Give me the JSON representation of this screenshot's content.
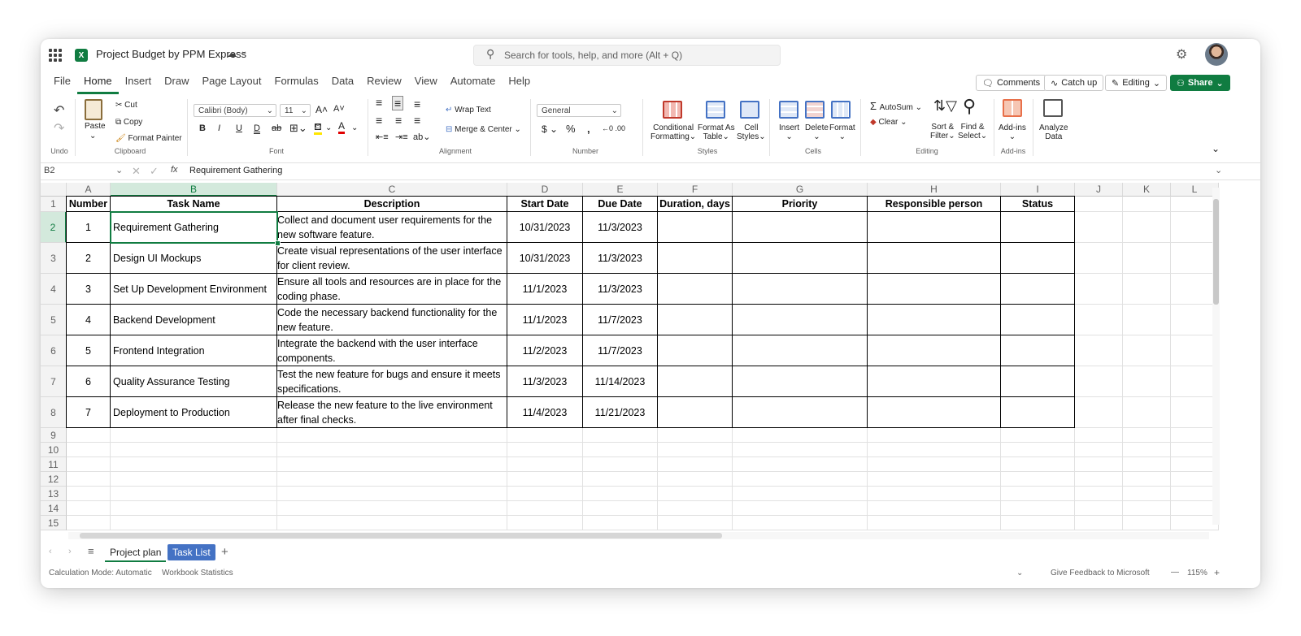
{
  "titlebar": {
    "doc_title": "Project Budget by PPM Express",
    "search_placeholder": "Search for tools, help, and more (Alt + Q)"
  },
  "menu": {
    "tabs": [
      "File",
      "Home",
      "Insert",
      "Draw",
      "Page Layout",
      "Formulas",
      "Data",
      "Review",
      "View",
      "Automate",
      "Help"
    ],
    "active": "Home",
    "comments": "Comments",
    "catch_up": "Catch up",
    "editing": "Editing",
    "share": "Share"
  },
  "ribbon": {
    "undo_label": "Undo",
    "clipboard": {
      "paste": "Paste",
      "cut": "Cut",
      "copy": "Copy",
      "format_painter": "Format Painter",
      "label": "Clipboard"
    },
    "font": {
      "family": "Calibri (Body)",
      "size": "11",
      "label": "Font"
    },
    "alignment": {
      "wrap_text": "Wrap Text",
      "merge_center": "Merge & Center",
      "label": "Alignment"
    },
    "number": {
      "format": "General",
      "label": "Number"
    },
    "styles": {
      "conditional_1": "Conditional",
      "conditional_2": "Formatting",
      "format_table_1": "Format As",
      "format_table_2": "Table",
      "cell_styles_1": "Cell",
      "cell_styles_2": "Styles",
      "label": "Styles"
    },
    "cells": {
      "insert": "Insert",
      "delete": "Delete",
      "format": "Format",
      "label": "Cells"
    },
    "editing": {
      "autosum": "AutoSum",
      "clear": "Clear",
      "sort_1": "Sort &",
      "sort_2": "Filter",
      "find_1": "Find &",
      "find_2": "Select",
      "label": "Editing"
    },
    "addins": {
      "addins": "Add-ins",
      "label": "Add-ins"
    },
    "analyze": {
      "l1": "Analyze",
      "l2": "Data"
    }
  },
  "formula_bar": {
    "name_box": "B2",
    "fx": "fx",
    "content": "Requirement Gathering"
  },
  "sheet": {
    "columns": [
      "A",
      "B",
      "C",
      "D",
      "E",
      "F",
      "G",
      "H",
      "I",
      "J",
      "K",
      "L"
    ],
    "rows": [
      "1",
      "2",
      "3",
      "4",
      "5",
      "6",
      "7",
      "8",
      "9",
      "10",
      "11",
      "12",
      "13",
      "14",
      "15"
    ],
    "headers": [
      "Number",
      "Task Name",
      "Description",
      "Start Date",
      "Due Date",
      "Duration, days",
      "Priority",
      "Responsible person",
      "Status"
    ],
    "data": [
      [
        "1",
        "Requirement Gathering",
        "Collect and document user requirements for the new software feature.",
        "10/31/2023",
        "11/3/2023"
      ],
      [
        "2",
        "Design UI Mockups",
        "Create visual representations of the user interface for client review.",
        "10/31/2023",
        "11/3/2023"
      ],
      [
        "3",
        "Set Up Development Environment",
        "Ensure all tools and resources are in place for the coding phase.",
        "11/1/2023",
        "11/3/2023"
      ],
      [
        "4",
        "Backend Development",
        "Code the necessary backend functionality for the new feature.",
        "11/1/2023",
        "11/7/2023"
      ],
      [
        "5",
        "Frontend Integration",
        "Integrate the backend with the user interface components.",
        "11/2/2023",
        "11/7/2023"
      ],
      [
        "6",
        "Quality Assurance Testing",
        "Test the new feature for bugs and ensure it meets specifications.",
        "11/3/2023",
        "11/14/2023"
      ],
      [
        "7",
        "Deployment to Production",
        "Release the new feature to the live environment after final checks.",
        "11/4/2023",
        "11/21/2023"
      ]
    ]
  },
  "sheet_tabs": {
    "tabs": [
      "Project plan",
      "Task List"
    ],
    "active": "Project plan",
    "add": "+"
  },
  "statusbar": {
    "calc_mode": "Calculation Mode: Automatic",
    "workbook_stats": "Workbook Statistics",
    "feedback": "Give Feedback to Microsoft",
    "zoom": "115%",
    "zoom_out": "—",
    "zoom_in": "+"
  },
  "colors": {
    "accent": "#107c41",
    "selected_header": "#d3e9dc",
    "tab_blue": "#4472c4"
  }
}
